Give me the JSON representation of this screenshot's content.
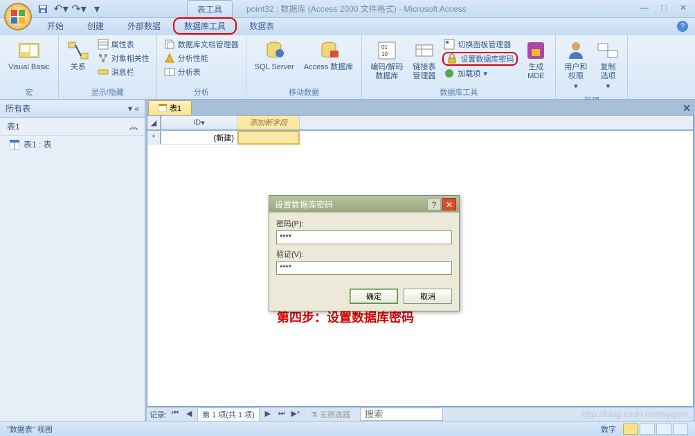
{
  "titlebar": {
    "context_tab": "表工具",
    "title": "point32 : 数据库 (Access 2000 文件格式) - Microsoft Access"
  },
  "ribbon_tabs": [
    "开始",
    "创建",
    "外部数据",
    "数据库工具",
    "数据表"
  ],
  "active_tab_index": 3,
  "ribbon": {
    "group1": {
      "label": "宏",
      "btn": "Visual Basic"
    },
    "group2": {
      "label": "显示/隐藏",
      "main": "关系",
      "items": [
        "属性表",
        "对象相关性",
        "消息栏"
      ]
    },
    "group3": {
      "label": "分析",
      "items": [
        "数据库文档管理器",
        "分析性能",
        "分析表"
      ]
    },
    "group4": {
      "label": "移动数据",
      "btn1": "SQL Server",
      "btn2": "Access 数据库"
    },
    "group5": {
      "label": "数据库工具",
      "btn1": "编码/解码\n数据库",
      "btn2": "链接表\n管理器",
      "items": [
        "切换面板管理器",
        "设置数据库密码",
        "加载项"
      ],
      "btn3": "生成\nMDE"
    },
    "group6": {
      "label": "管理",
      "btn1": "用户和\n权限",
      "btn2": "复制\n选项"
    }
  },
  "nav": {
    "header": "所有表",
    "section": "表1",
    "item": "表1 : 表"
  },
  "doc": {
    "tab": "表1",
    "col_id": "ID",
    "col_add": "添加新字段",
    "new_row": "(新建)"
  },
  "record_nav": {
    "label": "记录:",
    "pos": "第 1 项(共 1 项)",
    "filter": "无筛选器",
    "search": "搜索"
  },
  "dialog": {
    "title": "设置数据库密码",
    "pwd_label": "密码(P):",
    "pwd_value": "****",
    "verify_label": "验证(V):",
    "verify_value": "****",
    "ok": "确定",
    "cancel": "取消"
  },
  "status": {
    "view": "\"数据表\" 视图",
    "right": "数字"
  },
  "annotation": "第四步：设置数据库密码",
  "watermark": "http://blog.csdn.net/wyqmx"
}
